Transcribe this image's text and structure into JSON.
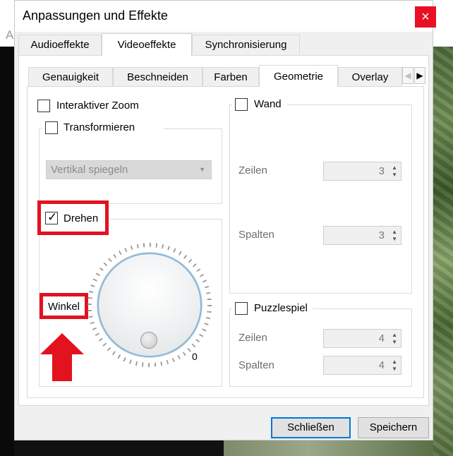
{
  "background": {
    "letter": "A"
  },
  "window": {
    "title": "Anpassungen und Effekte",
    "close_glyph": "×"
  },
  "top_tabs": [
    {
      "label": "Audioeffekte"
    },
    {
      "label": "Videoeffekte"
    },
    {
      "label": "Synchronisierung"
    }
  ],
  "sub_tabs": [
    {
      "label": "Genauigkeit"
    },
    {
      "label": "Beschneiden"
    },
    {
      "label": "Farben"
    },
    {
      "label": "Geometrie"
    },
    {
      "label": "Overlay"
    }
  ],
  "geometry": {
    "interactive_zoom": {
      "label": "Interaktiver Zoom",
      "checked": false
    },
    "transform": {
      "label": "Transformieren",
      "checked": false,
      "combo_value": "Vertikal spiegeln"
    },
    "rotate": {
      "label": "Drehen",
      "checked": true,
      "angle_label": "Winkel",
      "angle_value": "0"
    },
    "wall": {
      "label": "Wand",
      "checked": false,
      "rows_label": "Zeilen",
      "rows_value": "3",
      "cols_label": "Spalten",
      "cols_value": "3"
    },
    "puzzle": {
      "label": "Puzzlespiel",
      "checked": false,
      "rows_label": "Zeilen",
      "rows_value": "4",
      "cols_label": "Spalten",
      "cols_value": "4"
    }
  },
  "buttons": {
    "close": "Schließen",
    "save": "Speichern"
  },
  "colors": {
    "highlight": "#e3121f",
    "close_bg": "#e81123",
    "focus": "#0078d7"
  }
}
